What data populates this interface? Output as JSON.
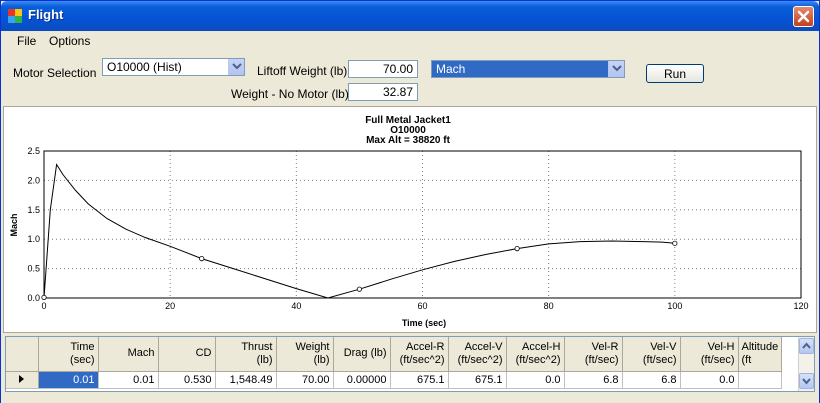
{
  "window": {
    "title": "Flight"
  },
  "menu": [
    "File",
    "Options"
  ],
  "controls": {
    "motor_label": "Motor Selection",
    "motor_value": "O10000  (Hist)",
    "liftoff_label": "Liftoff Weight (lb)",
    "liftoff_value": "70.00",
    "nomotor_label": "Weight - No Motor (lb)",
    "nomotor_value": "32.87",
    "plot_var": "Mach",
    "run_label": "Run"
  },
  "colors": {
    "title_bar": "#0553d4",
    "selection": "#316ac5",
    "close_button": "#c5401c"
  },
  "chart_data": {
    "type": "line",
    "title": [
      "Full Metal Jacket1",
      "O10000",
      "Max Alt = 38820 ft"
    ],
    "xlabel": "Time (sec)",
    "ylabel": "Mach",
    "xlim": [
      0,
      120
    ],
    "ylim": [
      0,
      2.5
    ],
    "xticks": [
      0,
      20,
      40,
      60,
      80,
      100,
      120
    ],
    "yticks": [
      0.0,
      0.5,
      1.0,
      1.5,
      2.0,
      2.5
    ],
    "grid": true,
    "series": [
      {
        "x": [
          0,
          1,
          2,
          3,
          5,
          7,
          10,
          13,
          16,
          20,
          25,
          30,
          35,
          40,
          45,
          50,
          55,
          60,
          65,
          70,
          75,
          80,
          85,
          90,
          95,
          98,
          100
        ],
        "values": [
          0.0,
          1.5,
          2.27,
          2.1,
          1.83,
          1.6,
          1.35,
          1.17,
          1.03,
          0.88,
          0.67,
          0.5,
          0.33,
          0.16,
          0.0,
          0.15,
          0.32,
          0.48,
          0.62,
          0.74,
          0.84,
          0.92,
          0.96,
          0.97,
          0.96,
          0.95,
          0.93
        ]
      }
    ],
    "markers": [
      {
        "x": 0,
        "y": 0.01
      },
      {
        "x": 25,
        "y": 0.67
      },
      {
        "x": 50,
        "y": 0.15
      },
      {
        "x": 75,
        "y": 0.84
      },
      {
        "x": 100,
        "y": 0.93
      }
    ]
  },
  "grid": {
    "headers": [
      [
        "Time",
        "(sec)"
      ],
      [
        "Mach",
        ""
      ],
      [
        "CD",
        ""
      ],
      [
        "Thrust",
        "(lb)"
      ],
      [
        "Weight",
        "(lb)"
      ],
      [
        "Drag (lb)",
        ""
      ],
      [
        "Accel-R",
        "(ft/sec^2)"
      ],
      [
        "Accel-V",
        "(ft/sec^2)"
      ],
      [
        "Accel-H",
        "(ft/sec^2)"
      ],
      [
        "Vel-R",
        "(ft/sec)"
      ],
      [
        "Vel-V",
        "(ft/sec)"
      ],
      [
        "Vel-H",
        "(ft/sec)"
      ],
      [
        "Altitude",
        "(ft"
      ]
    ],
    "rows": [
      [
        "0.01",
        "0.01",
        "0.530",
        "1,548.49",
        "70.00",
        "0.00000",
        "675.1",
        "675.1",
        "0.0",
        "6.8",
        "6.8",
        "0.0",
        ""
      ]
    ]
  }
}
